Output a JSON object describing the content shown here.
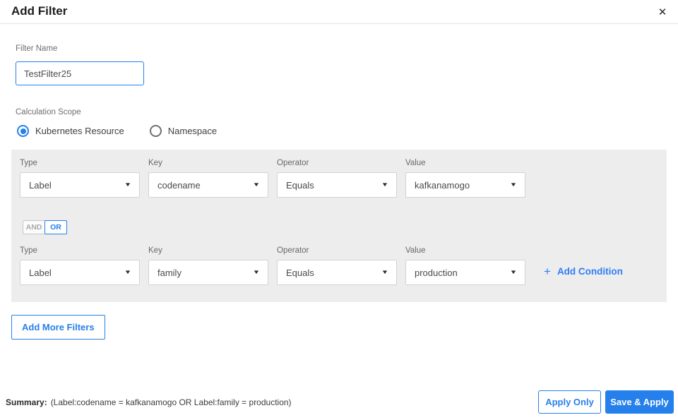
{
  "dialog": {
    "title": "Add Filter"
  },
  "icons": {
    "close": "✕",
    "caret": "▼",
    "plus": "+"
  },
  "filter_name": {
    "label": "Filter Name",
    "value": "TestFilter25"
  },
  "calculation_scope": {
    "label": "Calculation Scope",
    "options": [
      {
        "label": "Kubernetes Resource",
        "selected": true
      },
      {
        "label": "Namespace",
        "selected": false
      }
    ]
  },
  "conditions": {
    "columns": [
      "Type",
      "Key",
      "Operator",
      "Value"
    ],
    "rows": [
      {
        "type": "Label",
        "key": "codename",
        "operator": "Equals",
        "value": "kafkanamogo"
      },
      {
        "type": "Label",
        "key": "family",
        "operator": "Equals",
        "value": "production"
      }
    ],
    "logic_toggle": {
      "and_label": "AND",
      "or_label": "OR",
      "selected": "OR"
    },
    "add_condition_label": "Add Condition"
  },
  "add_more_filters_label": "Add More Filters",
  "footer": {
    "summary_label": "Summary:",
    "summary_text": "(Label:codename = kafkanamogo OR Label:family = production)",
    "apply_only_label": "Apply Only",
    "save_apply_label": "Save & Apply"
  },
  "colors": {
    "accent": "#2680eb",
    "panel_bg": "#ededed"
  }
}
